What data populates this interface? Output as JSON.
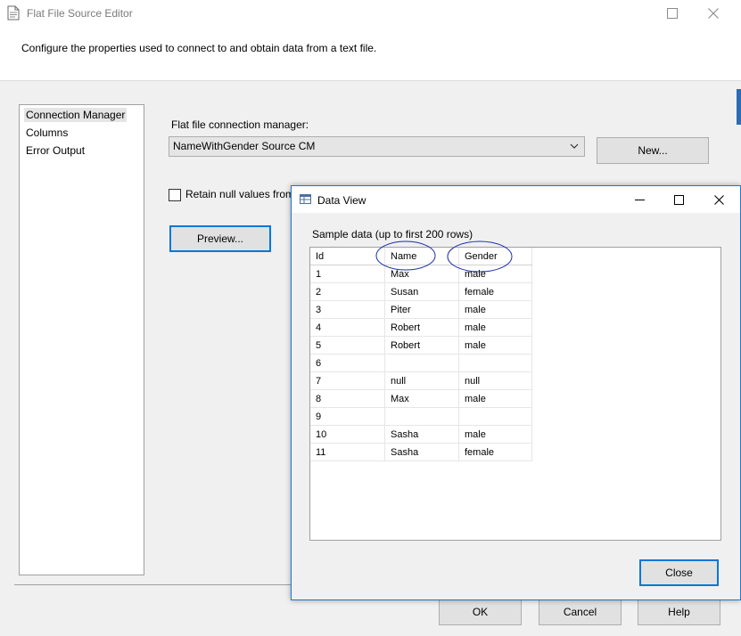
{
  "window": {
    "title": "Flat File Source Editor",
    "description": "Configure the properties used to connect to and obtain data from a text file."
  },
  "nav": {
    "items": [
      {
        "label": "Connection Manager",
        "selected": true
      },
      {
        "label": "Columns",
        "selected": false
      },
      {
        "label": "Error Output",
        "selected": false
      }
    ]
  },
  "connection": {
    "label": "Flat file connection manager:",
    "value": "NameWithGender Source CM",
    "new_button": "New..."
  },
  "retain": {
    "label": "Retain null values from",
    "checked": false
  },
  "preview_button": "Preview...",
  "footer": {
    "ok": "OK",
    "cancel": "Cancel",
    "help": "Help"
  },
  "data_view": {
    "title": "Data View",
    "sample_label": "Sample data (up to first 200 rows)",
    "columns": [
      "Id",
      "Name",
      "Gender"
    ],
    "rows": [
      [
        "1",
        "Max",
        "male"
      ],
      [
        "2",
        "Susan",
        "female"
      ],
      [
        "3",
        "Piter",
        "male"
      ],
      [
        "4",
        "Robert",
        "male"
      ],
      [
        "5",
        "Robert",
        "male"
      ],
      [
        "6",
        "",
        ""
      ],
      [
        "7",
        "null",
        "null"
      ],
      [
        "8",
        "Max",
        "male"
      ],
      [
        "9",
        "",
        ""
      ],
      [
        "10",
        "Sasha",
        "male"
      ],
      [
        "11",
        "Sasha",
        "female"
      ]
    ],
    "close_button": "Close",
    "annotation_color": "#1a2db0"
  },
  "colors": {
    "accent": "#0078d7",
    "dialog_border": "#1a78d0"
  }
}
